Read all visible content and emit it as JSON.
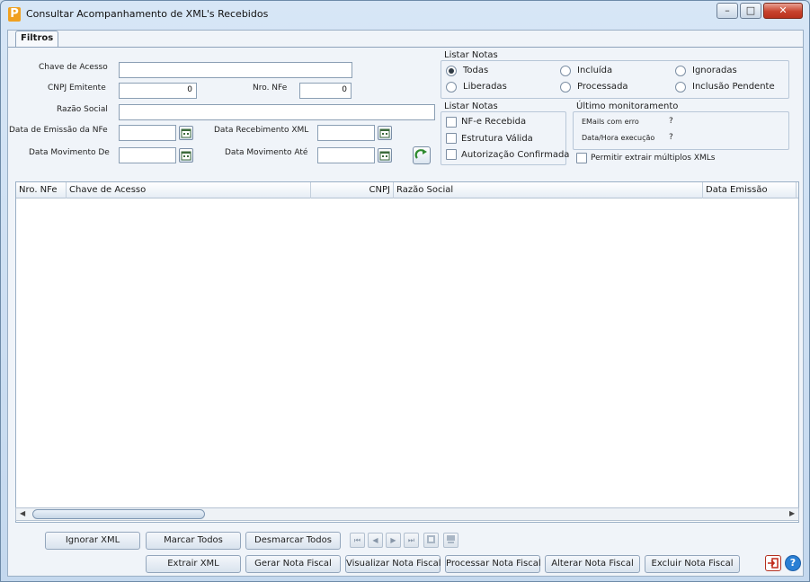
{
  "window": {
    "title": "Consultar Acompanhamento de XML's Recebidos",
    "app_icon": "P",
    "controls": {
      "minimize": "–",
      "maximize": "□",
      "close": "✕"
    }
  },
  "tabs": [
    {
      "label": "Filtros",
      "active": true
    }
  ],
  "filters": {
    "chave_acesso": {
      "label": "Chave de Acesso",
      "value": ""
    },
    "cnpj_emitente": {
      "label": "CNPJ Emitente",
      "value": "0"
    },
    "nro_nfe": {
      "label": "Nro. NFe",
      "value": "0"
    },
    "razao_social": {
      "label": "Razão Social",
      "value": ""
    },
    "data_emissao": {
      "label": "Data de Emissão da NFe",
      "value": ""
    },
    "data_recebimento": {
      "label": "Data Recebimento XML",
      "value": ""
    },
    "data_mov_de": {
      "label": "Data Movimento De",
      "value": ""
    },
    "data_mov_ate": {
      "label": "Data Movimento Até",
      "value": ""
    }
  },
  "listar_notas_radio": {
    "title": "Listar Notas",
    "options": [
      "Todas",
      "Incluída",
      "Ignoradas",
      "Liberadas",
      "Processada",
      "Inclusão Pendente"
    ],
    "selected": "Todas"
  },
  "listar_notas_check": {
    "title": "Listar Notas",
    "options": [
      "NF-e Recebida",
      "Estrutura Válida",
      "Autorização Confirmada"
    ]
  },
  "ultimo_monitoramento": {
    "title": "Último monitoramento",
    "email_label": "EMails com erro",
    "email_value": "?",
    "data_label": "Data/Hora execução",
    "data_value": "?"
  },
  "permitir_multiplos": {
    "label": "Permitir extrair múltiplos XMLs",
    "checked": false
  },
  "grid": {
    "columns": [
      "Nro. NFe",
      "Chave de Acesso",
      "CNPJ",
      "Razão Social",
      "Data Emissão"
    ],
    "rows": []
  },
  "buttons": {
    "ignorar": "Ignorar XML",
    "marcar": "Marcar Todos",
    "desmarcar": "Desmarcar Todos",
    "extrair": "Extrair XML",
    "gerar": "Gerar Nota Fiscal",
    "visualizar": "Visualizar Nota Fiscal",
    "processar": "Processar Nota Fiscal",
    "alterar": "Alterar Nota Fiscal",
    "excluir": "Excluir Nota Fiscal"
  },
  "navigation": {
    "first": "⏮",
    "prev": "◀",
    "next": "▶",
    "last": "⏭"
  },
  "colors": {
    "window_bg": "#cfdff0",
    "client_bg": "#f0f4f9",
    "close_red": "#c8432d",
    "help_blue": "#2a7fd4",
    "exit_red": "#c02a1a"
  }
}
